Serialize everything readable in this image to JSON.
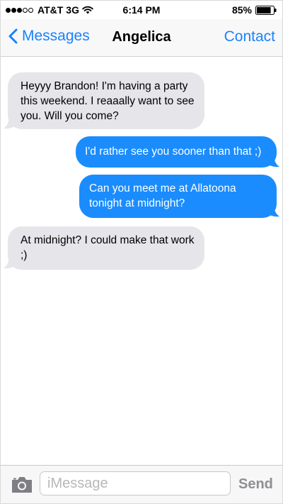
{
  "status_bar": {
    "carrier": "AT&T",
    "network": "3G",
    "time": "6:14 PM",
    "battery_percent": "85%",
    "signal_bars_filled": 3,
    "signal_bars_total": 5,
    "battery_level": 0.85
  },
  "nav": {
    "back_label": "Messages",
    "title": "Angelica",
    "contact_label": "Contact",
    "accent_color": "#1a82fb"
  },
  "messages": [
    {
      "direction": "received",
      "lines": [
        "Heyyy Brandon! I'm having a party",
        "this weekend. I reaaally want to see",
        "you. Will you come?"
      ]
    },
    {
      "direction": "sent",
      "lines": [
        "I'd rather see you sooner than that ;)"
      ]
    },
    {
      "direction": "sent",
      "lines": [
        "Can you meet me at Allatoona",
        "tonight at midnight?"
      ]
    },
    {
      "direction": "received",
      "lines": [
        "At midnight? I could make that work",
        ";)"
      ]
    }
  ],
  "input_bar": {
    "placeholder": "iMessage",
    "value": "",
    "send_label": "Send",
    "camera_icon": "camera-icon"
  },
  "colors": {
    "sent_bubble": "#1a8cfe",
    "received_bubble": "#e5e5ea"
  }
}
